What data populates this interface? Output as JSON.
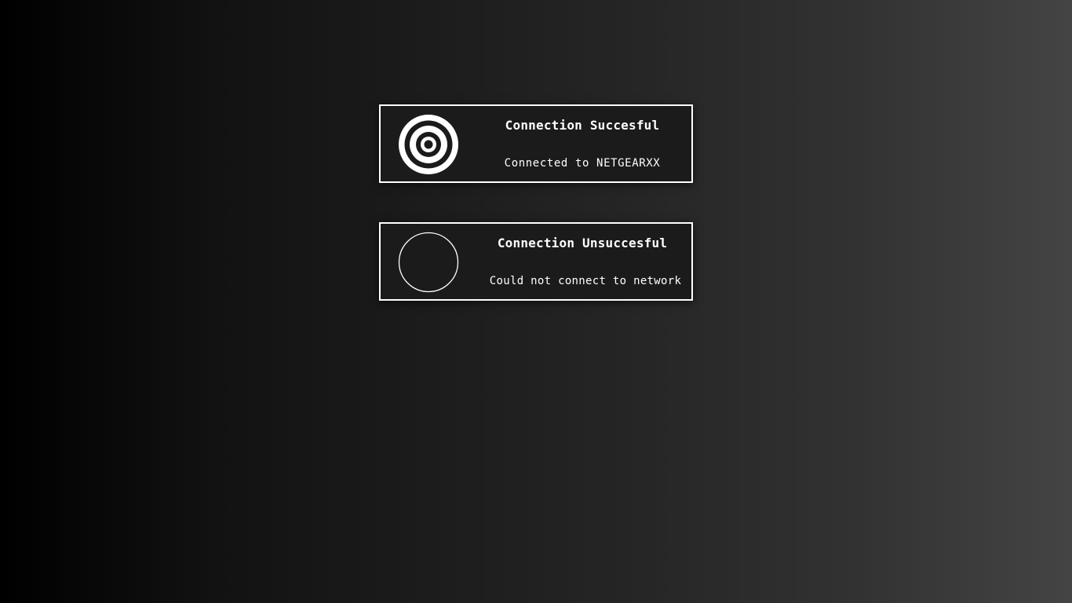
{
  "notifications": [
    {
      "status": "success",
      "icon": "target-icon",
      "title": "Connection Succesful",
      "message": "Connected to NETGEARXX"
    },
    {
      "status": "failure",
      "icon": "empty-circle-icon",
      "title": "Connection Unsuccesful",
      "message": "Could not connect to network"
    }
  ],
  "colors": {
    "foreground": "#ffffff",
    "card_background": "#1b1b1b",
    "background_start": "#000000",
    "background_end": "#444444"
  }
}
